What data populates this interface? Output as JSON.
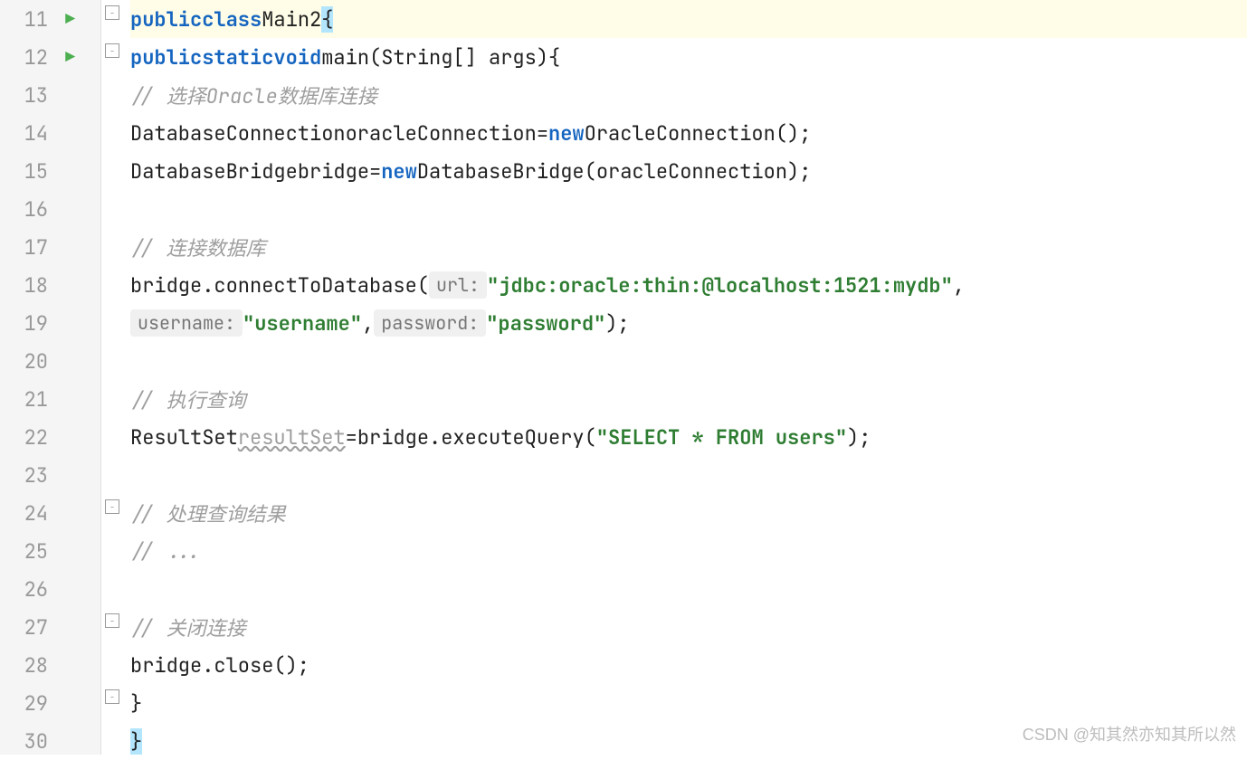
{
  "gutter": {
    "lines": [
      "11",
      "12",
      "13",
      "14",
      "15",
      "16",
      "17",
      "18",
      "19",
      "20",
      "21",
      "22",
      "23",
      "24",
      "25",
      "26",
      "27",
      "28",
      "29",
      "30"
    ],
    "runIcons": {
      "11": true,
      "12": true
    }
  },
  "code": {
    "line11": {
      "kw_public": "public",
      "kw_class": "class",
      "class_name": "Main2",
      "brace": "{"
    },
    "line12": {
      "kw_public": "public",
      "kw_static": "static",
      "kw_void": "void",
      "method_name": "main",
      "params": "(String[] args)",
      "brace": "{"
    },
    "line13": {
      "comment": "// 选择Oracle数据库连接"
    },
    "line14": {
      "type1": "DatabaseConnection",
      "var1": "oracleConnection",
      "eq": "=",
      "kw_new": "new",
      "ctor": "OracleConnection()",
      "semi": ";"
    },
    "line15": {
      "type1": "DatabaseBridge",
      "var1": "bridge",
      "eq": "=",
      "kw_new": "new",
      "ctor": "DatabaseBridge(oracleConnection)",
      "semi": ";"
    },
    "line17": {
      "comment": "// 连接数据库"
    },
    "line18": {
      "call": "bridge.connectToDatabase(",
      "hint_url": "url:",
      "str_url": "\"jdbc:oracle:thin:@localhost:1521:mydb\"",
      "comma": ","
    },
    "line19": {
      "hint_username": "username:",
      "str_username": "\"username\"",
      "comma1": ",",
      "hint_password": "password:",
      "str_password": "\"password\"",
      "close": ");"
    },
    "line21": {
      "comment": "// 执行查询"
    },
    "line22": {
      "type1": "ResultSet",
      "var1": "resultSet",
      "eq": "=",
      "call": "bridge.executeQuery(",
      "str": "\"SELECT * FROM users\"",
      "close": ");"
    },
    "line24": {
      "comment": "// 处理查询结果"
    },
    "line25": {
      "comment": "// ..."
    },
    "line27": {
      "comment": "// 关闭连接"
    },
    "line28": {
      "call": "bridge.close();"
    },
    "line29": {
      "brace": "}"
    },
    "line30": {
      "brace": "}"
    }
  },
  "watermark": "CSDN @知其然亦知其所以然"
}
